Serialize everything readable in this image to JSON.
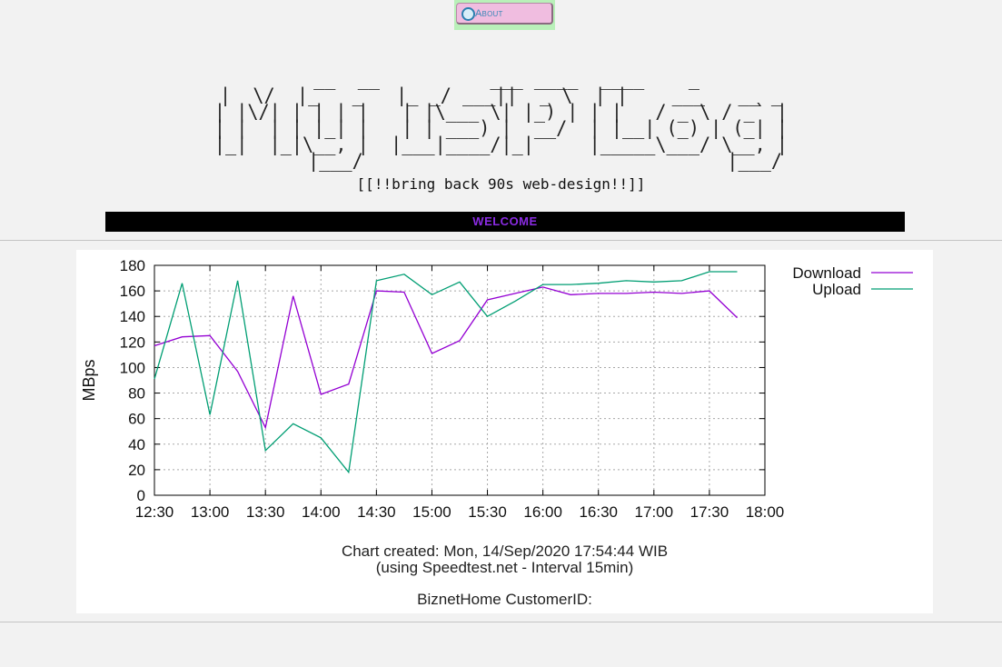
{
  "about": {
    "label": "About"
  },
  "logo": {
    "art": " __  __          ___ ____  ____    _\n|  \\/  |_   _   |_ _/ ___||  _ \\  | |    ___   __ _\n| |\\/| | | | |   | |\\___ \\| |_) | | |   / _ \\ / _` |\n| |  | | |_| |   | | ___) |  __/  | |__| (_) | (_| |\n|_|  |_|\\__, |  |___|____/|_|     |_____\\___/ \\__, |\n        |___/                                 |___/",
    "tagline": "[[!!bring back 90s web-design!!]]"
  },
  "welcome": {
    "label": "WELCOME"
  },
  "chart_data": {
    "type": "line",
    "x": [
      "12:30",
      "12:45",
      "13:00",
      "13:15",
      "13:30",
      "13:45",
      "14:00",
      "14:15",
      "14:30",
      "14:45",
      "15:00",
      "15:15",
      "15:30",
      "15:45",
      "16:00",
      "16:15",
      "16:30",
      "16:45",
      "17:00",
      "17:15",
      "17:30",
      "17:45"
    ],
    "series": [
      {
        "name": "Download",
        "color": "#9400d3",
        "values": [
          117,
          124,
          125,
          97,
          53,
          156,
          79,
          87,
          160,
          159,
          111,
          121,
          153,
          158,
          163,
          157,
          158,
          158,
          159,
          158,
          160,
          139
        ]
      },
      {
        "name": "Upload",
        "color": "#009e73",
        "values": [
          91,
          166,
          63,
          168,
          35,
          56,
          45,
          18,
          168,
          173,
          157,
          167,
          140,
          152,
          165,
          165,
          166,
          168,
          167,
          168,
          175,
          175
        ]
      }
    ],
    "ylabel": "MBps",
    "xlabel": "",
    "ylim": [
      0,
      180
    ],
    "yticks": [
      0,
      20,
      40,
      60,
      80,
      100,
      120,
      140,
      160,
      180
    ],
    "xticks": [
      "12:30",
      "13:00",
      "13:30",
      "14:00",
      "14:30",
      "15:00",
      "15:30",
      "16:00",
      "16:30",
      "17:00",
      "17:30",
      "18:00"
    ],
    "grid": true,
    "legend_position": "top-right"
  },
  "captions": {
    "line1": "Chart created: Mon, 14/Sep/2020  17:54:44 WIB",
    "line2": "(using Speedtest.net - Interval 15min)",
    "line3": "BiznetHome CustomerID:"
  }
}
